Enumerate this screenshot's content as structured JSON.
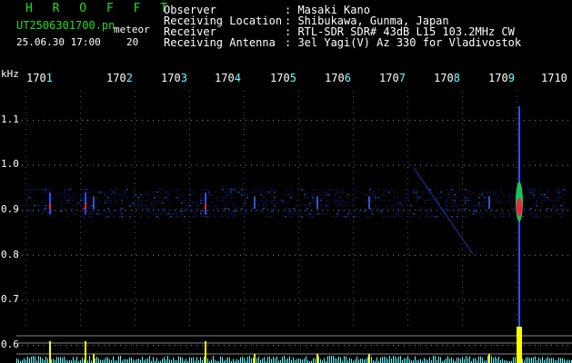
{
  "header": {
    "app_title": "H R O F F T",
    "filename": "UT2506301700.pn",
    "mode": "meteor",
    "datetime": "25.06.30 17:00",
    "interval": "20",
    "info_rows": [
      {
        "label": "Observer",
        "value": ": Masaki Kano"
      },
      {
        "label": "Receiving Location",
        "value": ": Shibukawa, Gunma, Japan"
      },
      {
        "label": "Receiver",
        "value": ": RTL-SDR SDR# 43dB L15 103.2MHz CW"
      },
      {
        "label": "Receiving Antenna",
        "value": ": 3el Yagi(V) Az 330 for Vladivostok"
      }
    ]
  },
  "colors": {
    "label_green": "#22dd22",
    "text_white": "#ffffff",
    "level_yellow": "#ffff00",
    "noise_cyan": "#66ffff",
    "echo_blue": "#2040ff",
    "echo_red": "#ff2040"
  },
  "chart_data": {
    "type": "heatmap",
    "y_unit": "kHz",
    "x_ticks": [
      "170",
      "170",
      "170",
      "170",
      "170",
      "170",
      "170",
      "170",
      "170",
      "1710"
    ],
    "x_tick_suffixes": [
      "1",
      "2",
      "3",
      "4",
      "5",
      "6",
      "7",
      "8",
      "9",
      ""
    ],
    "y_ticks": [
      "1.1",
      "1.0",
      "0.9",
      "0.8",
      "0.7",
      "0.6"
    ],
    "y_tick_values": [
      1.1,
      1.0,
      0.9,
      0.8,
      0.7,
      0.6
    ],
    "ylim": [
      0.58,
      1.16
    ],
    "xlim": [
      17000,
      17100
    ],
    "carrier_band_khz": 0.918,
    "echoes": [
      {
        "minute": 17004.5,
        "strength": "medium"
      },
      {
        "minute": 17011,
        "strength": "medium"
      },
      {
        "minute": 17012.5,
        "strength": "weak"
      },
      {
        "minute": 17033,
        "strength": "medium"
      },
      {
        "minute": 17042,
        "strength": "weak"
      },
      {
        "minute": 17053.5,
        "strength": "weak"
      },
      {
        "minute": 17063,
        "strength": "weak"
      },
      {
        "minute": 17085,
        "strength": "weak"
      },
      {
        "minute": 17090.5,
        "strength": "strong"
      }
    ]
  }
}
